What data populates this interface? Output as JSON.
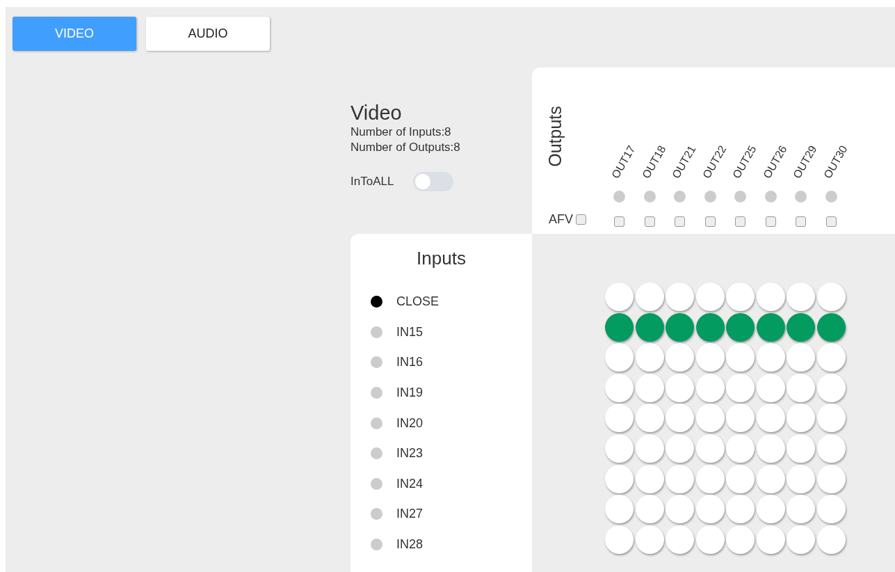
{
  "tabs": [
    {
      "label": "VIDEO",
      "selected": true
    },
    {
      "label": "AUDIO",
      "selected": false
    }
  ],
  "section": {
    "title": "Video",
    "inputs_count": "Number of Inputs:8",
    "outputs_count": "Number of Outputs:8",
    "into_all": {
      "label": "InToALL",
      "on": false
    }
  },
  "outputs": {
    "title": "Outputs",
    "afv": {
      "label": "AFV",
      "checked": false
    },
    "items": [
      {
        "label": "OUT17",
        "selected": false,
        "afv": false
      },
      {
        "label": "OUT18",
        "selected": false,
        "afv": false
      },
      {
        "label": "OUT21",
        "selected": false,
        "afv": false
      },
      {
        "label": "OUT22",
        "selected": false,
        "afv": false
      },
      {
        "label": "OUT25",
        "selected": false,
        "afv": false
      },
      {
        "label": "OUT26",
        "selected": false,
        "afv": false
      },
      {
        "label": "OUT29",
        "selected": false,
        "afv": false
      },
      {
        "label": "OUT30",
        "selected": false,
        "afv": false
      }
    ]
  },
  "inputs": {
    "title": "Inputs",
    "items": [
      {
        "label": "CLOSE",
        "selected": true
      },
      {
        "label": "IN15",
        "selected": false
      },
      {
        "label": "IN16",
        "selected": false
      },
      {
        "label": "IN19",
        "selected": false
      },
      {
        "label": "IN20",
        "selected": false
      },
      {
        "label": "IN23",
        "selected": false
      },
      {
        "label": "IN24",
        "selected": false
      },
      {
        "label": "IN27",
        "selected": false
      },
      {
        "label": "IN28",
        "selected": false
      }
    ]
  },
  "matrix": {
    "rows": [
      {
        "connected": [
          false,
          false,
          false,
          false,
          false,
          false,
          false,
          false
        ]
      },
      {
        "connected": [
          true,
          true,
          true,
          true,
          true,
          true,
          true,
          true
        ]
      },
      {
        "connected": [
          false,
          false,
          false,
          false,
          false,
          false,
          false,
          false
        ]
      },
      {
        "connected": [
          false,
          false,
          false,
          false,
          false,
          false,
          false,
          false
        ]
      },
      {
        "connected": [
          false,
          false,
          false,
          false,
          false,
          false,
          false,
          false
        ]
      },
      {
        "connected": [
          false,
          false,
          false,
          false,
          false,
          false,
          false,
          false
        ]
      },
      {
        "connected": [
          false,
          false,
          false,
          false,
          false,
          false,
          false,
          false
        ]
      },
      {
        "connected": [
          false,
          false,
          false,
          false,
          false,
          false,
          false,
          false
        ]
      },
      {
        "connected": [
          false,
          false,
          false,
          false,
          false,
          false,
          false,
          false
        ]
      }
    ]
  }
}
